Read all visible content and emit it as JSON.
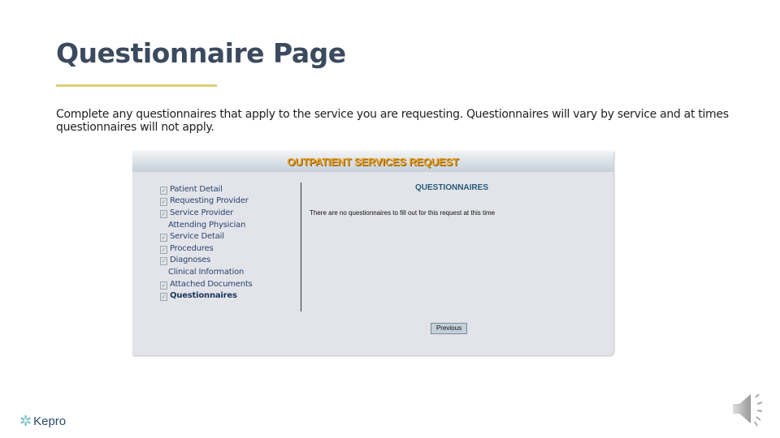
{
  "slide": {
    "title": "Questionnaire Page",
    "description": "Complete any questionnaires that apply to the service you are requesting.  Questionnaires will vary by service and at times questionnaires will not apply."
  },
  "screenshot": {
    "header": "OUTPATIENT SERVICES REQUEST",
    "nav": [
      {
        "label": "Patient Detail",
        "icon": true
      },
      {
        "label": "Requesting Provider",
        "icon": true
      },
      {
        "label": "Service Provider",
        "icon": true
      },
      {
        "label": "Attending Physician",
        "icon": false
      },
      {
        "label": "Service Detail",
        "icon": true
      },
      {
        "label": "Procedures",
        "icon": true
      },
      {
        "label": "Diagnoses",
        "icon": true
      },
      {
        "label": "Clinical Information",
        "icon": false
      },
      {
        "label": "Attached Documents",
        "icon": true
      },
      {
        "label": "Questionnaires",
        "icon": true,
        "active": true
      }
    ],
    "section_title": "QUESTIONNAIRES",
    "message": "There are no questionnaires to fill out for this request at this time",
    "previous_label": "Previous"
  },
  "footer": {
    "logo_text": "Kepro"
  }
}
